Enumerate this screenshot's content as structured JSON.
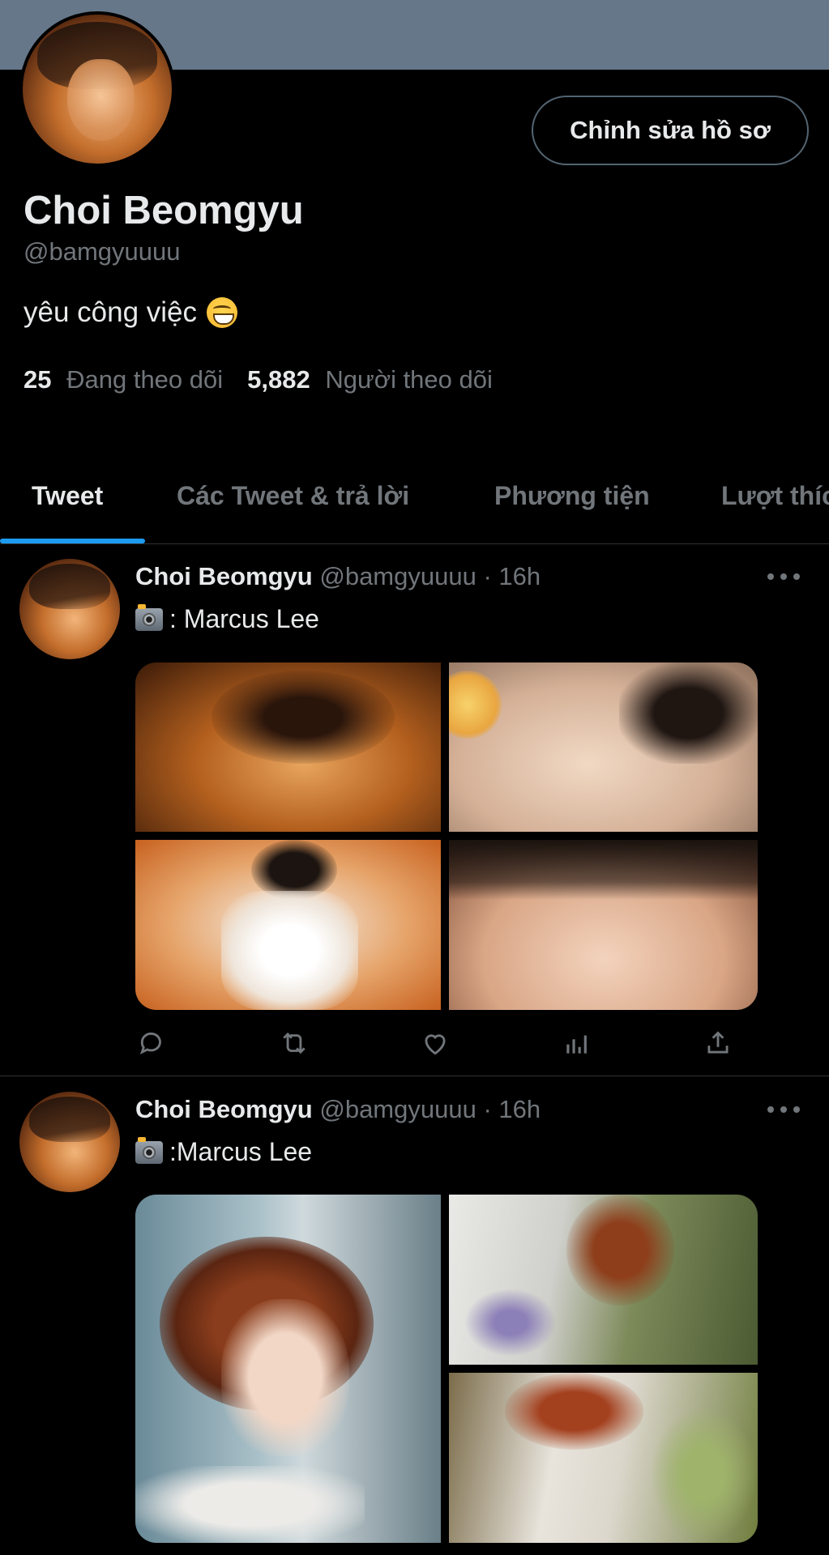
{
  "profile": {
    "display_name": "Choi Beomgyu",
    "handle": "@bamgyuuuu",
    "bio": "yêu công việc",
    "edit_button_label": "Chỉnh sửa hồ sơ",
    "following_count": "25",
    "following_label": "Đang theo dõi",
    "followers_count": "5,882",
    "followers_label": "Người theo dõi",
    "bio_emoji_icon": "grinning-face-icon"
  },
  "tabs": [
    {
      "label": "Tweet",
      "active": true
    },
    {
      "label": "Các Tweet & trả lời",
      "active": false
    },
    {
      "label": "Phương tiện",
      "active": false
    },
    {
      "label": "Lượt thích",
      "active": false
    }
  ],
  "tweets": [
    {
      "name": "Choi Beomgyu",
      "meta": "@bamgyuuuu · 16h",
      "text": ": Marcus Lee",
      "text_icon": "camera-flash-icon"
    },
    {
      "name": "Choi Beomgyu",
      "meta": "@bamgyuuuu · 16h",
      "text": ":Marcus Lee",
      "text_icon": "camera-flash-icon"
    }
  ],
  "colors": {
    "accent": "#1d9bf0",
    "banner": "#66778a",
    "background": "#000000",
    "muted_text": "#71767b"
  },
  "action_icons": [
    "reply-icon",
    "retweet-icon",
    "like-icon",
    "analytics-icon",
    "share-icon"
  ]
}
